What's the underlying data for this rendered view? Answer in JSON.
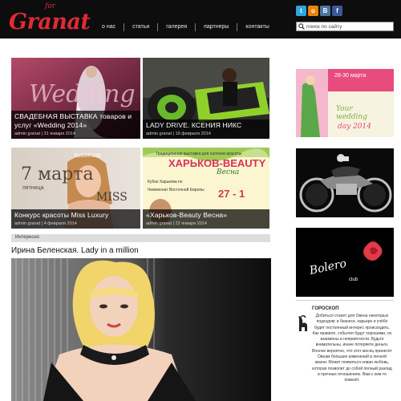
{
  "logo": {
    "text": "Granat",
    "superscript": "for"
  },
  "nav": {
    "items": [
      {
        "label": "о нас"
      },
      {
        "label": "статьи"
      },
      {
        "label": "галерея"
      },
      {
        "label": "партнеры"
      },
      {
        "label": "контакты"
      }
    ]
  },
  "social": [
    {
      "icon": "twitter-icon",
      "glyph": "t",
      "color": "#2fa6de"
    },
    {
      "icon": "odnoklassniki-icon",
      "glyph": "о",
      "color": "#ee8208"
    },
    {
      "icon": "vkontakte-icon",
      "glyph": "B",
      "color": "#4c75a3"
    },
    {
      "icon": "facebook-icon",
      "glyph": "f",
      "color": "#3b5998"
    }
  ],
  "search": {
    "placeholder": "поиск по сайту"
  },
  "tiles": [
    {
      "title": "СВАДЕБНАЯ ВЫСТАВКА товаров и услуг «Wedding 2014»",
      "meta": "admin granat  |  31 января 2014",
      "overlay_text": "Wedding"
    },
    {
      "title": "LADY DRIVE. КСЕНИЯ НИКС",
      "meta": "admin granat  |  19 февраля 2014",
      "overlay_text": ""
    },
    {
      "title": "Конкурс красоты Miss Luxury",
      "meta": "admin granat  |  4 февраля 2014",
      "overlay_text": "7 марта",
      "overlay_text_2": "пятница",
      "overlay_text_3": "MISS",
      "overlay_text_4": "museum"
    },
    {
      "title": "«Харьков-Beauty Весна»",
      "meta": "admin granat  |  22 января 2014",
      "overlay_text": "ХАРЬКОВ-BEAUTY",
      "overlay_text_2": "Весна",
      "overlay_text_3": "27 - 1",
      "overlay_text_4": "Традиционная выставка для салонов красоты",
      "overlay_text_5": "Кубок Харькова по",
      "overlay_text_6": "Чемпионат Восточной Европы"
    }
  ],
  "section": {
    "label": "Интересно"
  },
  "article": {
    "title": "Ирина Беленская. Lady in a million"
  },
  "ads": {
    "wedding_day": {
      "line1": "28-30 марта",
      "line2": "Your",
      "line3": "wedding",
      "line4": "day 2014"
    },
    "bolero": {
      "brand": "Bolero",
      "sub": "club"
    }
  },
  "horoscope": {
    "title": "ГОРОСКОП",
    "text": "Добиться станет для Овена некоторых подходом: в бизнесе, карьере и учёбе будет постоянный интерес происходить. Как правило, события будут хорошими, но взаимоны и неприятности. Будьте внимательны, иначе потеряете деньги. Вполне вероятно, что этот месяц принесёт Овнам больших изменений в личной жизни. Может появиться новая любовь, которая позволит до собой полный разлад в прочных отношениях. Вам с кем-то повезёт."
  },
  "colors": {
    "brand": "#e02a35",
    "header_bg": "#0d0d0d"
  }
}
